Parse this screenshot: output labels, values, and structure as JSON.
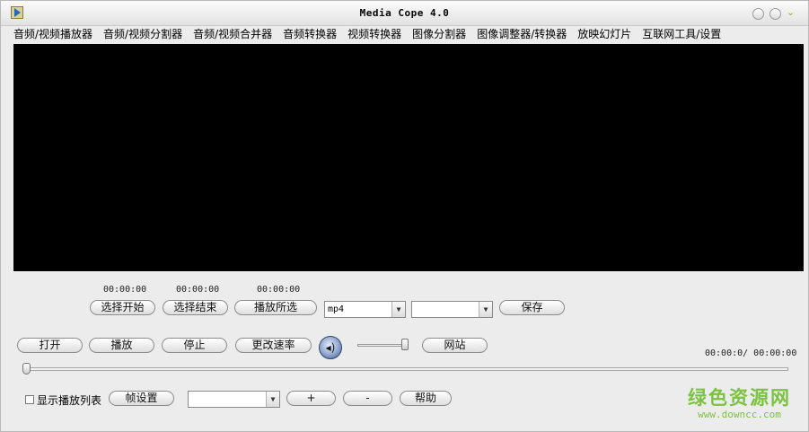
{
  "window": {
    "title": "Media Cope 4.0"
  },
  "menu": [
    "音频/视频播放器",
    "音频/视频分割器",
    "音频/视频合并器",
    "音频转换器",
    "视频转换器",
    "图像分割器",
    "图像调整器/转换器",
    "放映幻灯片",
    "互联网工具/设置"
  ],
  "selection": {
    "start_time": "00:00:00",
    "end_time": "00:00:00",
    "play_time": "00:00:00",
    "start_label": "选择开始",
    "end_label": "选择结束",
    "play_label": "播放所选",
    "format_value": "mp4",
    "format2_value": "",
    "save_label": "保存"
  },
  "controls": {
    "open_label": "打开",
    "play_label": "播放",
    "stop_label": "停止",
    "speed_label": "更改速率",
    "volume_icon": "speaker-icon",
    "volume_level": 0.9,
    "website_label": "网站",
    "time_display": "00:00:0/ 00:00:00",
    "seek_position": 0
  },
  "bottom": {
    "show_playlist_label": "显示播放列表",
    "show_playlist_checked": false,
    "frame_settings_label": "帧设置",
    "frame_select_value": "",
    "plus_label": "+",
    "minus_label": "-",
    "help_label": "帮助"
  },
  "watermark": {
    "main": "绿色资源网",
    "url": "www.downcc.com"
  },
  "colors": {
    "video_bg": "#000000",
    "watermark": "#7cc242"
  }
}
